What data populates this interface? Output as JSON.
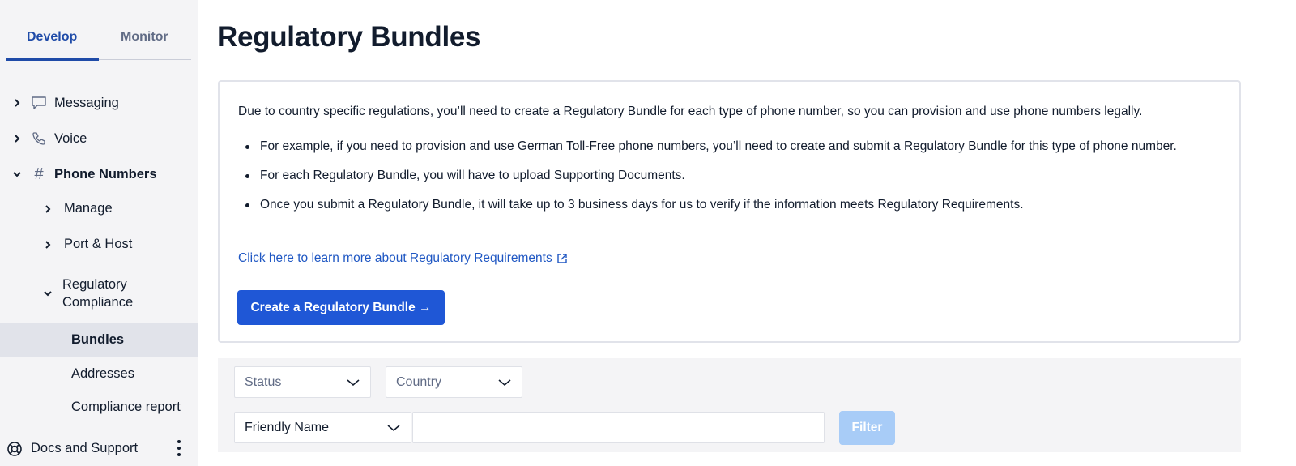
{
  "sidebar": {
    "tabs": [
      {
        "label": "Develop",
        "active": true
      },
      {
        "label": "Monitor",
        "active": false
      }
    ],
    "items": [
      {
        "label": "Messaging",
        "icon": "chat-bubble-icon",
        "expanded": false
      },
      {
        "label": "Voice",
        "icon": "phone-icon",
        "expanded": false
      },
      {
        "label": "Phone Numbers",
        "icon": "hash-icon",
        "expanded": true
      },
      {
        "label": "Manage",
        "expanded": false
      },
      {
        "label": "Port & Host",
        "expanded": false
      },
      {
        "label": "Regulatory Compliance",
        "expanded": true
      },
      {
        "label": "Bundles",
        "selected": true
      },
      {
        "label": "Addresses"
      },
      {
        "label": "Compliance report"
      }
    ],
    "docs_label": "Docs and Support"
  },
  "main": {
    "title": "Regulatory Bundles",
    "info": {
      "intro": "Due to country specific regulations, you’ll need to create a Regulatory Bundle for each type of phone number, so you can provision and use phone numbers legally.",
      "bullets": [
        "For example, if you need to provision and use German Toll-Free phone numbers, you’ll need to create and submit a Regulatory Bundle for this type of phone number.",
        "For each Regulatory Bundle, you will have to upload Supporting Documents.",
        "Once you submit a Regulatory Bundle, it will take up to 3 business days for us to verify if the information meets Regulatory Requirements."
      ],
      "link": "Click here to learn more about Regulatory Requirements",
      "create_button": "Create a Regulatory Bundle →"
    },
    "filters": {
      "status_placeholder": "Status",
      "country_placeholder": "Country",
      "field_select": "Friendly Name",
      "text_value": "",
      "filter_button": "Filter"
    }
  },
  "colors": {
    "accent": "#1f57d6",
    "link": "#1f57c3",
    "active_tab": "#1f4ba8",
    "disabled_button": "#a8ccf7",
    "sidebar_bg": "#f4f4f6",
    "selected_row": "#e1e3ea"
  }
}
